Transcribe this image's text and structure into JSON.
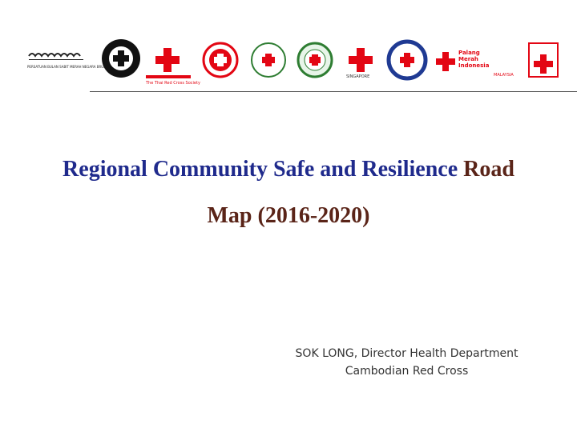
{
  "logos": [
    {
      "name": "brunei red crescent",
      "text": "PERSATUAN BULAN SABIT MERAH NEGARA BRUNEI DARUSSALAM",
      "color": "#c1121f"
    },
    {
      "name": "myanmar red cross",
      "color": "#000000"
    },
    {
      "name": "thai red cross",
      "text": "The Thai Red Cross Society",
      "color": "#e30613"
    },
    {
      "name": "cambodian red cross",
      "color": "#e30613"
    },
    {
      "name": "lao red cross",
      "color": "#2e7d32"
    },
    {
      "name": "vietnam red cross",
      "color": "#2e7d32"
    },
    {
      "name": "singapore red cross",
      "text": "SINGAPORE",
      "color": "#e30613"
    },
    {
      "name": "philippine red cross",
      "color": "#1f3a93"
    },
    {
      "name": "indonesian red cross",
      "text": "Palang Merah Indonesia",
      "color": "#e30613"
    },
    {
      "name": "malaysian red crescent",
      "text": "MALAYSIA",
      "color": "#e30613"
    },
    {
      "name": "timor-leste red cross",
      "color": "#e30613"
    }
  ],
  "title": {
    "line1_blue": "Regional  Community Safe and Resilience",
    "line1_brown": " Road",
    "line2_brown": "Map (2016-2020)"
  },
  "presenter": {
    "line1": "SOK LONG, Director Health Department",
    "line2": "Cambodian Red Cross"
  },
  "colors": {
    "title_blue": "#1f2a8c",
    "title_brown": "#5a2418",
    "divider": "#555555",
    "red_cross": "#e30613"
  }
}
